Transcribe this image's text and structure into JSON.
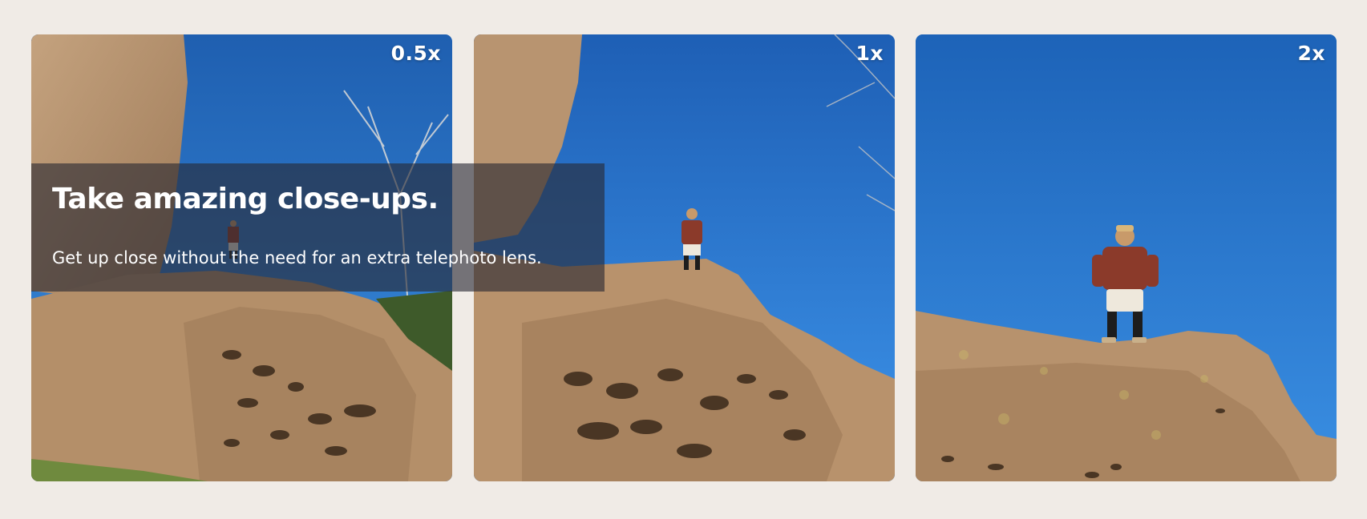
{
  "caption": {
    "title": "Take amazing close-ups.",
    "subtitle": "Get up close without the need for an extra telephoto lens."
  },
  "photos": [
    {
      "zoom_label": "0.5x",
      "subject": "hiker standing on rock, ultra-wide view"
    },
    {
      "zoom_label": "1x",
      "subject": "hiker standing on rock, standard view"
    },
    {
      "zoom_label": "2x",
      "subject": "hiker standing on rock, telephoto view"
    }
  ],
  "colors": {
    "page_background": "#f0ebe6",
    "sky": "#2f7fd6",
    "rock": "#b08e6a",
    "caption_overlay": "rgba(40,40,50,0.62)",
    "label_text": "#ffffff"
  }
}
